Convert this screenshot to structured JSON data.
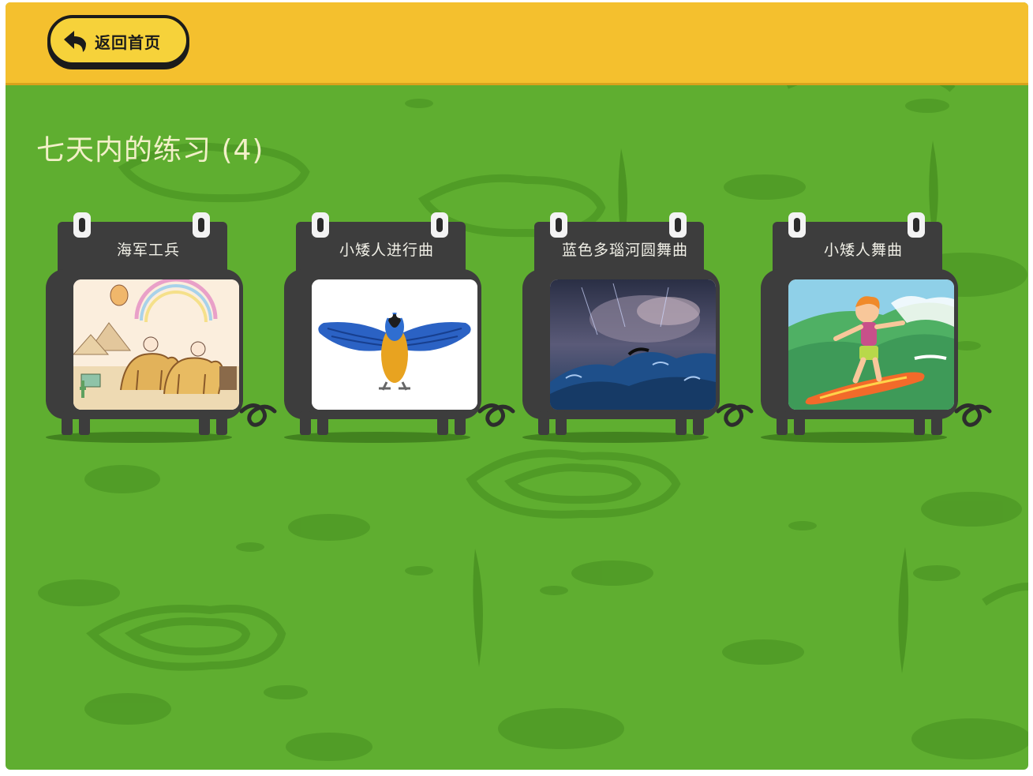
{
  "header": {
    "back_label": "返回首页",
    "back_icon": "arrow-left-icon"
  },
  "section": {
    "title": "七天内的练习 (4)"
  },
  "items": [
    {
      "title": "海军工兵",
      "thumbnail": "desert-camels-image"
    },
    {
      "title": "小矮人进行曲",
      "thumbnail": "parrot-image"
    },
    {
      "title": "蓝色多瑙河圆舞曲",
      "thumbnail": "stormy-sea-image"
    },
    {
      "title": "小矮人舞曲",
      "thumbnail": "surfer-boy-image"
    }
  ],
  "colors": {
    "header_bg": "#f4c02e",
    "background": "#5fae30",
    "tv_body": "#3d3d3d",
    "title_text": "#f2f0c8"
  }
}
